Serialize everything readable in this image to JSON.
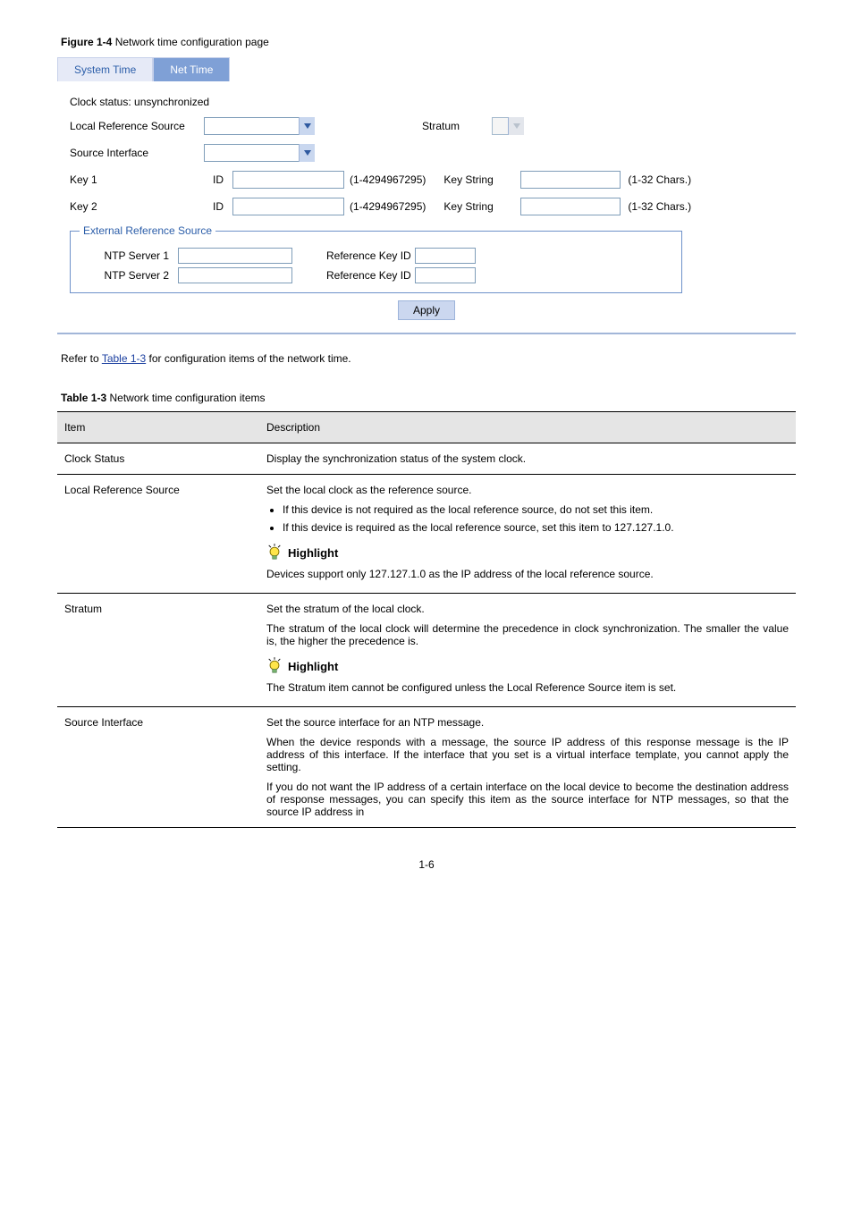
{
  "figure": {
    "label": "Figure 1-4",
    "title": "Network time configuration page"
  },
  "ui": {
    "tabs": {
      "system_time": "System Time",
      "net_time": "Net Time"
    },
    "clock_status": "Clock status: unsynchronized",
    "local_ref_source_label": "Local Reference Source",
    "stratum_label": "Stratum",
    "source_interface_label": "Source Interface",
    "key1_label": "Key 1",
    "key2_label": "Key 2",
    "id_label": "ID",
    "id_range": "(1-4294967295)",
    "keystring_label": "Key String",
    "chars_range": "(1-32 Chars.)",
    "ext_legend": "External Reference Source",
    "ntp1_label": "NTP Server 1",
    "ntp2_label": "NTP Server 2",
    "ref_key_label": "Reference Key ID",
    "apply": "Apply"
  },
  "after_figure": {
    "prefix": "Refer to ",
    "link": "Table 1-3",
    "suffix": " for configuration items of the network time."
  },
  "table": {
    "label": "Table 1-3",
    "title": "Network time configuration items",
    "headers": {
      "item": "Item",
      "desc": "Description"
    },
    "rows": {
      "clock_status": {
        "item": "Clock Status",
        "desc": "Display the synchronization status of the system clock."
      },
      "local_ref": {
        "item": "Local Reference Source",
        "intro": "Set the local clock as the reference source.",
        "b1": "If this device is not required as the local reference source, do not set this item.",
        "b2": "If this device is required as the local reference source, set this item to 127.127.1.0.",
        "hl_label": "Highlight",
        "hl_note": "Devices support only 127.127.1.0 as the IP address of the local reference source."
      },
      "stratum": {
        "item": "Stratum",
        "p1": "Set the stratum of the local clock.",
        "p2": "The stratum of the local clock will determine the precedence in clock synchronization. The smaller the value is, the higher the precedence is.",
        "hl_label": "Highlight",
        "hl_note": "The Stratum item cannot be configured unless the Local Reference Source item is set."
      },
      "src_if": {
        "item": "Source Interface",
        "p1": "Set the source interface for an NTP message.",
        "p2": "When the device responds with a message, the source IP address of this response message is the IP address of this interface. If the interface that you set is a virtual interface template, you cannot apply the setting.",
        "p3": "If you do not want the IP address of a certain interface on the local device to become the destination address of response messages, you can specify this item as the source interface for NTP messages, so that the source IP address in"
      }
    }
  },
  "page_number": "1-6"
}
